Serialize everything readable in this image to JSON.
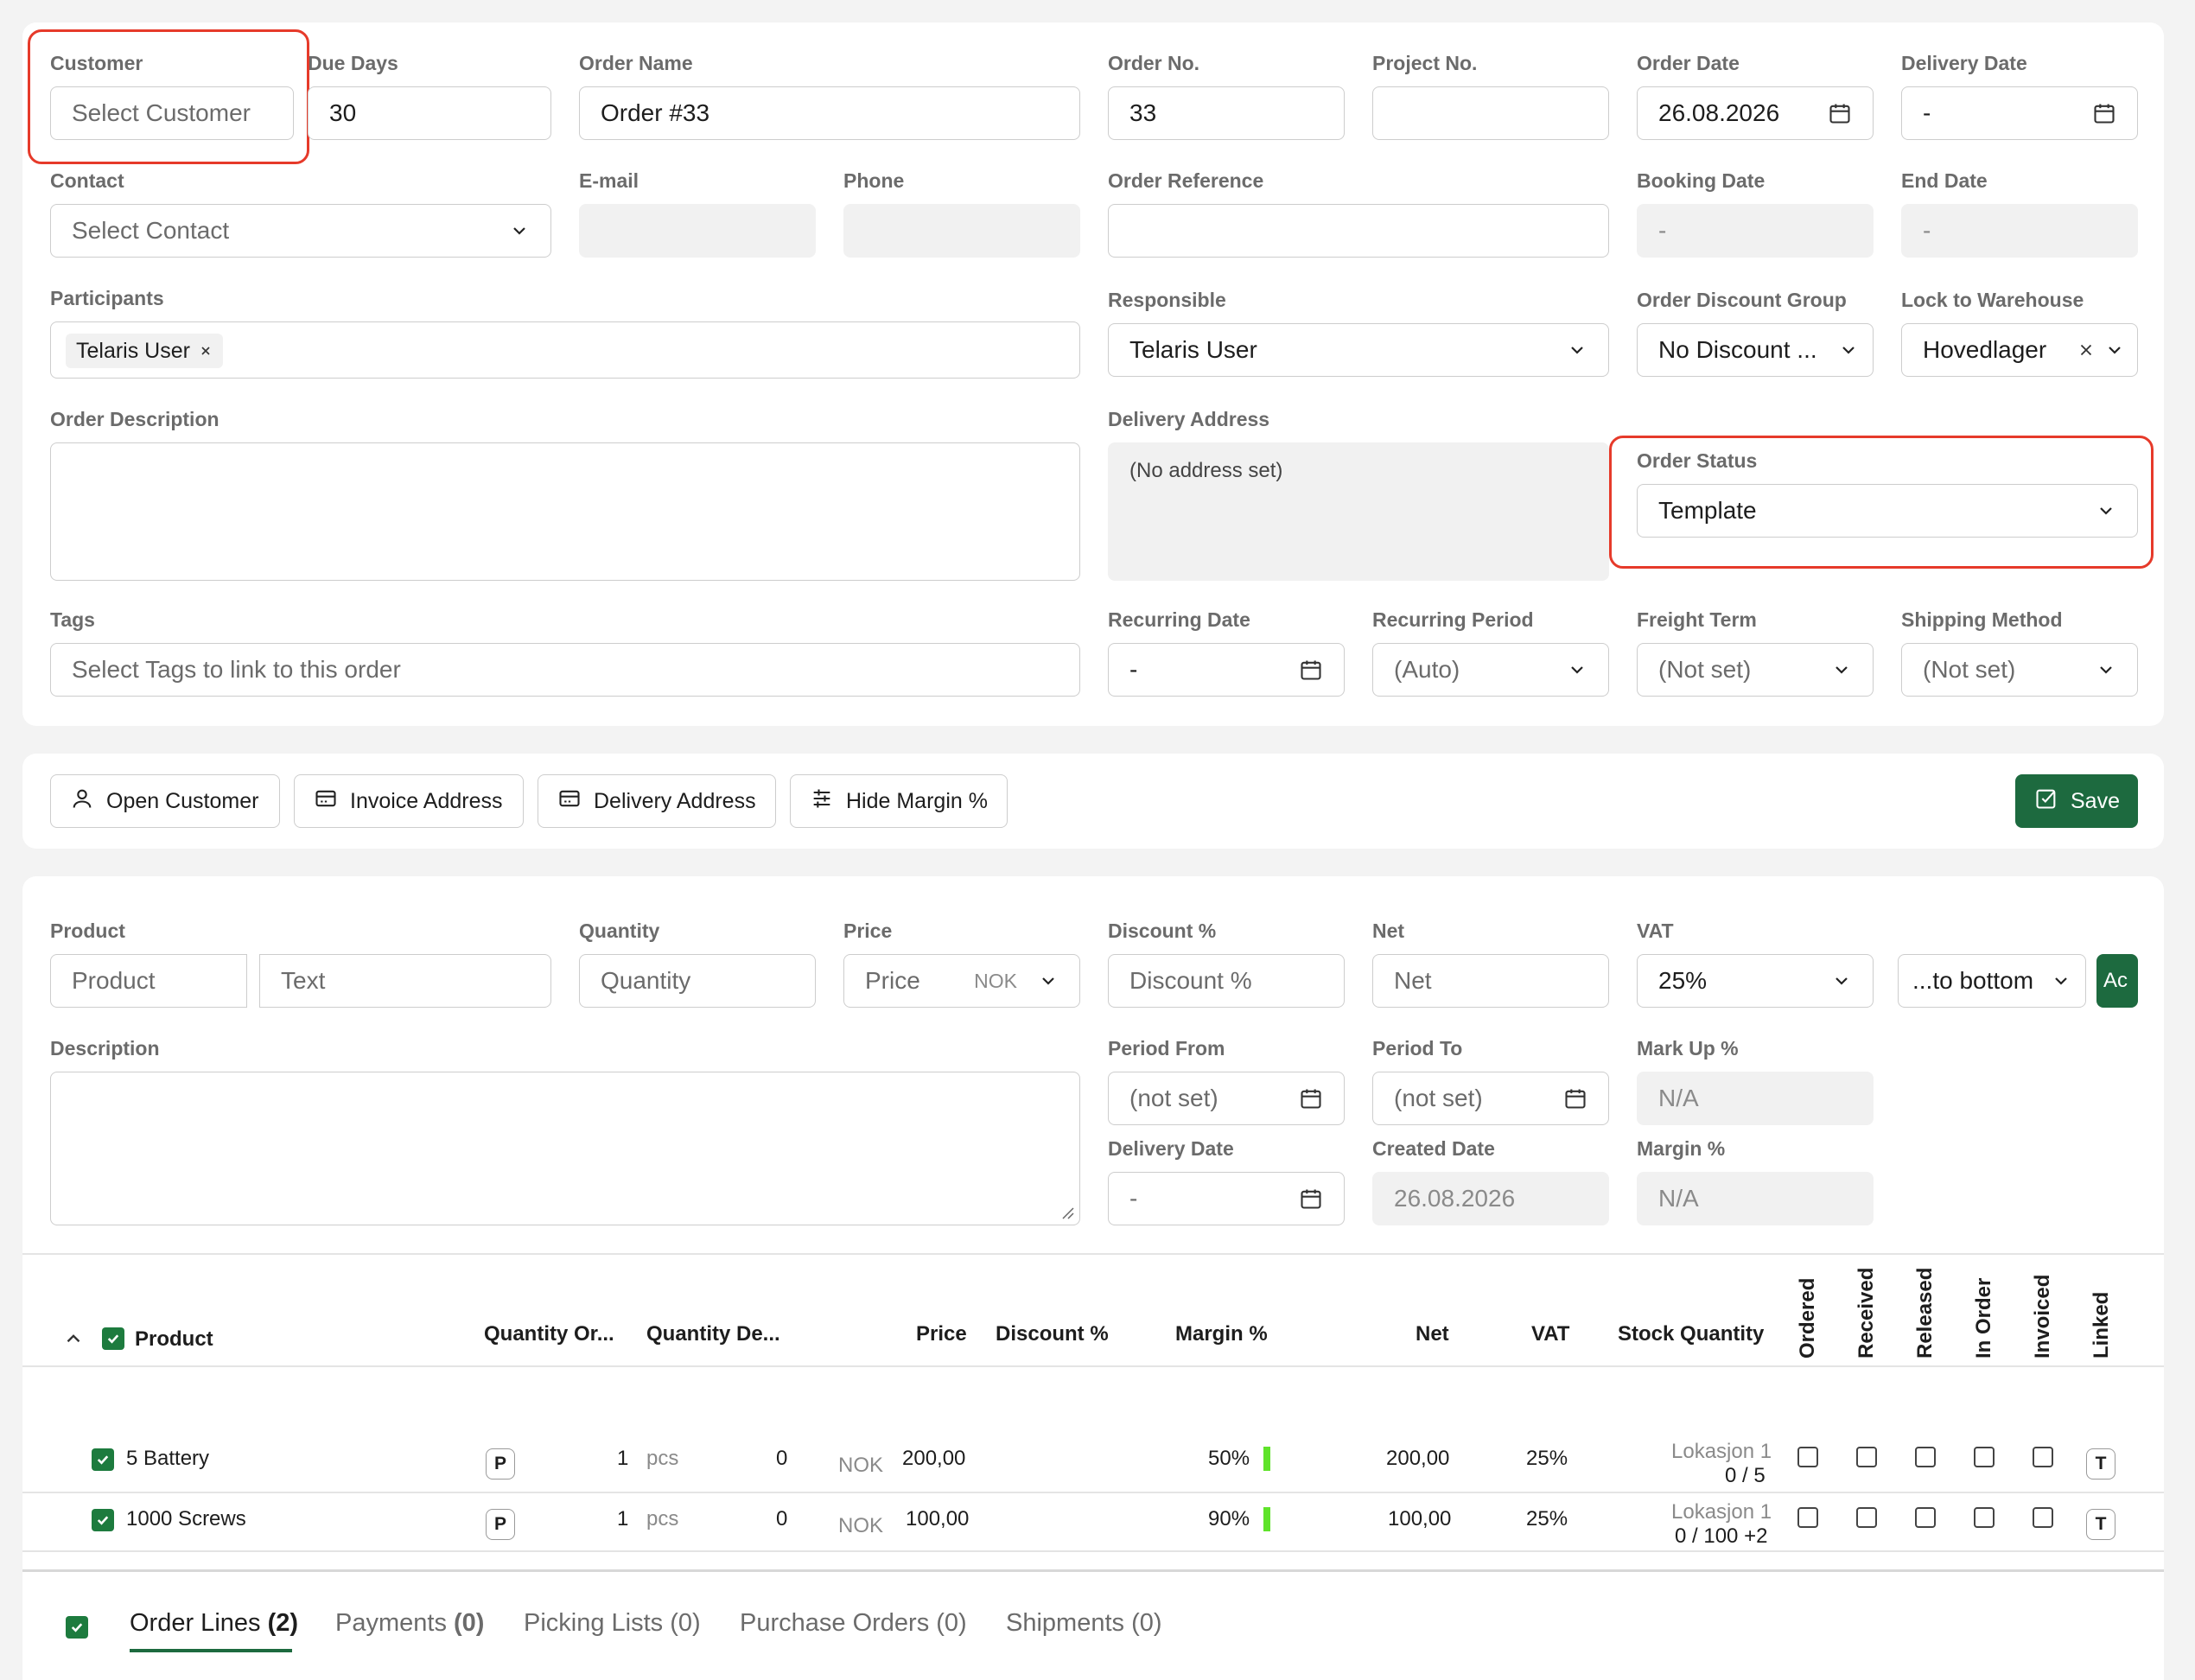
{
  "form": {
    "customer": {
      "label": "Customer",
      "placeholder": "Select Customer"
    },
    "due_days": {
      "label": "Due Days",
      "value": "30"
    },
    "order_name": {
      "label": "Order Name",
      "value": "Order #33"
    },
    "order_no": {
      "label": "Order No.",
      "value": "33"
    },
    "project_no": {
      "label": "Project No.",
      "value": ""
    },
    "order_date": {
      "label": "Order Date",
      "value": "26.08.2026"
    },
    "delivery_date": {
      "label": "Delivery Date",
      "value": "-"
    },
    "contact": {
      "label": "Contact",
      "placeholder": "Select Contact"
    },
    "email": {
      "label": "E-mail",
      "value": ""
    },
    "phone": {
      "label": "Phone",
      "value": ""
    },
    "order_reference": {
      "label": "Order Reference",
      "value": ""
    },
    "booking_date": {
      "label": "Booking Date",
      "value": "-"
    },
    "end_date": {
      "label": "End Date",
      "value": "-"
    },
    "participants": {
      "label": "Participants",
      "chips": [
        "Telaris User"
      ]
    },
    "responsible": {
      "label": "Responsible",
      "value": "Telaris User"
    },
    "order_discount_group": {
      "label": "Order Discount Group",
      "value": "No Discount ..."
    },
    "lock_to_warehouse": {
      "label": "Lock to Warehouse",
      "value": "Hovedlager"
    },
    "order_description": {
      "label": "Order Description",
      "value": ""
    },
    "delivery_address": {
      "label": "Delivery Address",
      "value": "(No address set)"
    },
    "order_status": {
      "label": "Order Status",
      "value": "Template"
    },
    "tags": {
      "label": "Tags",
      "placeholder": "Select Tags to link to this order"
    },
    "recurring_date": {
      "label": "Recurring Date",
      "value": "-"
    },
    "recurring_period": {
      "label": "Recurring Period",
      "value": "(Auto)"
    },
    "freight_term": {
      "label": "Freight Term",
      "value": "(Not set)"
    },
    "shipping_method": {
      "label": "Shipping Method",
      "value": "(Not set)"
    }
  },
  "toolbar": {
    "open_customer": "Open Customer",
    "invoice_address": "Invoice Address",
    "delivery_address": "Delivery Address",
    "hide_margin": "Hide Margin %",
    "save": "Save"
  },
  "line_form": {
    "product": {
      "label": "Product",
      "placeholder": "Product"
    },
    "text": {
      "placeholder": "Text"
    },
    "quantity": {
      "label": "Quantity",
      "placeholder": "Quantity"
    },
    "price": {
      "label": "Price",
      "placeholder": "Price",
      "currency": "NOK"
    },
    "discount": {
      "label": "Discount %",
      "placeholder": "Discount %"
    },
    "net": {
      "label": "Net",
      "placeholder": "Net"
    },
    "vat": {
      "label": "VAT",
      "value": "25%"
    },
    "position": {
      "value": "...to bottom"
    },
    "add_button": "Ac",
    "description": {
      "label": "Description",
      "value": ""
    },
    "period_from": {
      "label": "Period From",
      "value": "(not set)"
    },
    "period_to": {
      "label": "Period To",
      "value": "(not set)"
    },
    "mark_up": {
      "label": "Mark Up %",
      "value": "N/A"
    },
    "delivery_date": {
      "label": "Delivery Date",
      "value": "-"
    },
    "created_date": {
      "label": "Created Date",
      "value": "26.08.2026"
    },
    "margin": {
      "label": "Margin %",
      "value": "N/A"
    }
  },
  "table": {
    "headers": {
      "product": "Product",
      "qty_ordered": "Quantity Or...",
      "qty_delivered": "Quantity De...",
      "price": "Price",
      "discount": "Discount %",
      "margin": "Margin %",
      "net": "Net",
      "vat": "VAT",
      "stock": "Stock Quantity",
      "ordered": "Ordered",
      "received": "Received",
      "released": "Released",
      "in_order": "In Order",
      "invoiced": "Invoiced",
      "linked": "Linked"
    },
    "rows": [
      {
        "product": "5 Battery",
        "type": "P",
        "qty": "1",
        "unit": "pcs",
        "delivered": "0",
        "currency": "NOK",
        "price": "200,00",
        "margin": "50%",
        "net": "200,00",
        "vat": "25%",
        "stock_location": "Lokasjon 1",
        "stock_qty": "0 / 5",
        "linked": "T"
      },
      {
        "product": "1000 Screws",
        "type": "P",
        "qty": "1",
        "unit": "pcs",
        "delivered": "0",
        "currency": "NOK",
        "price": "100,00",
        "margin": "90%",
        "net": "100,00",
        "vat": "25%",
        "stock_location": "Lokasjon 1",
        "stock_qty": "0 / 100 +2",
        "linked": "T"
      }
    ]
  },
  "tabs": [
    {
      "label": "Order Lines",
      "count": "(2)"
    },
    {
      "label": "Payments",
      "count": "(0)"
    },
    {
      "label": "Picking Lists",
      "count": "(0)"
    },
    {
      "label": "Purchase Orders",
      "count": "(0)"
    },
    {
      "label": "Shipments",
      "count": "(0)"
    }
  ],
  "colors": {
    "accent": "#1d6a3f",
    "highlight": "#e63a2a",
    "checkbox": "#1d7b3e",
    "margin_bar": "#5fe32a"
  }
}
